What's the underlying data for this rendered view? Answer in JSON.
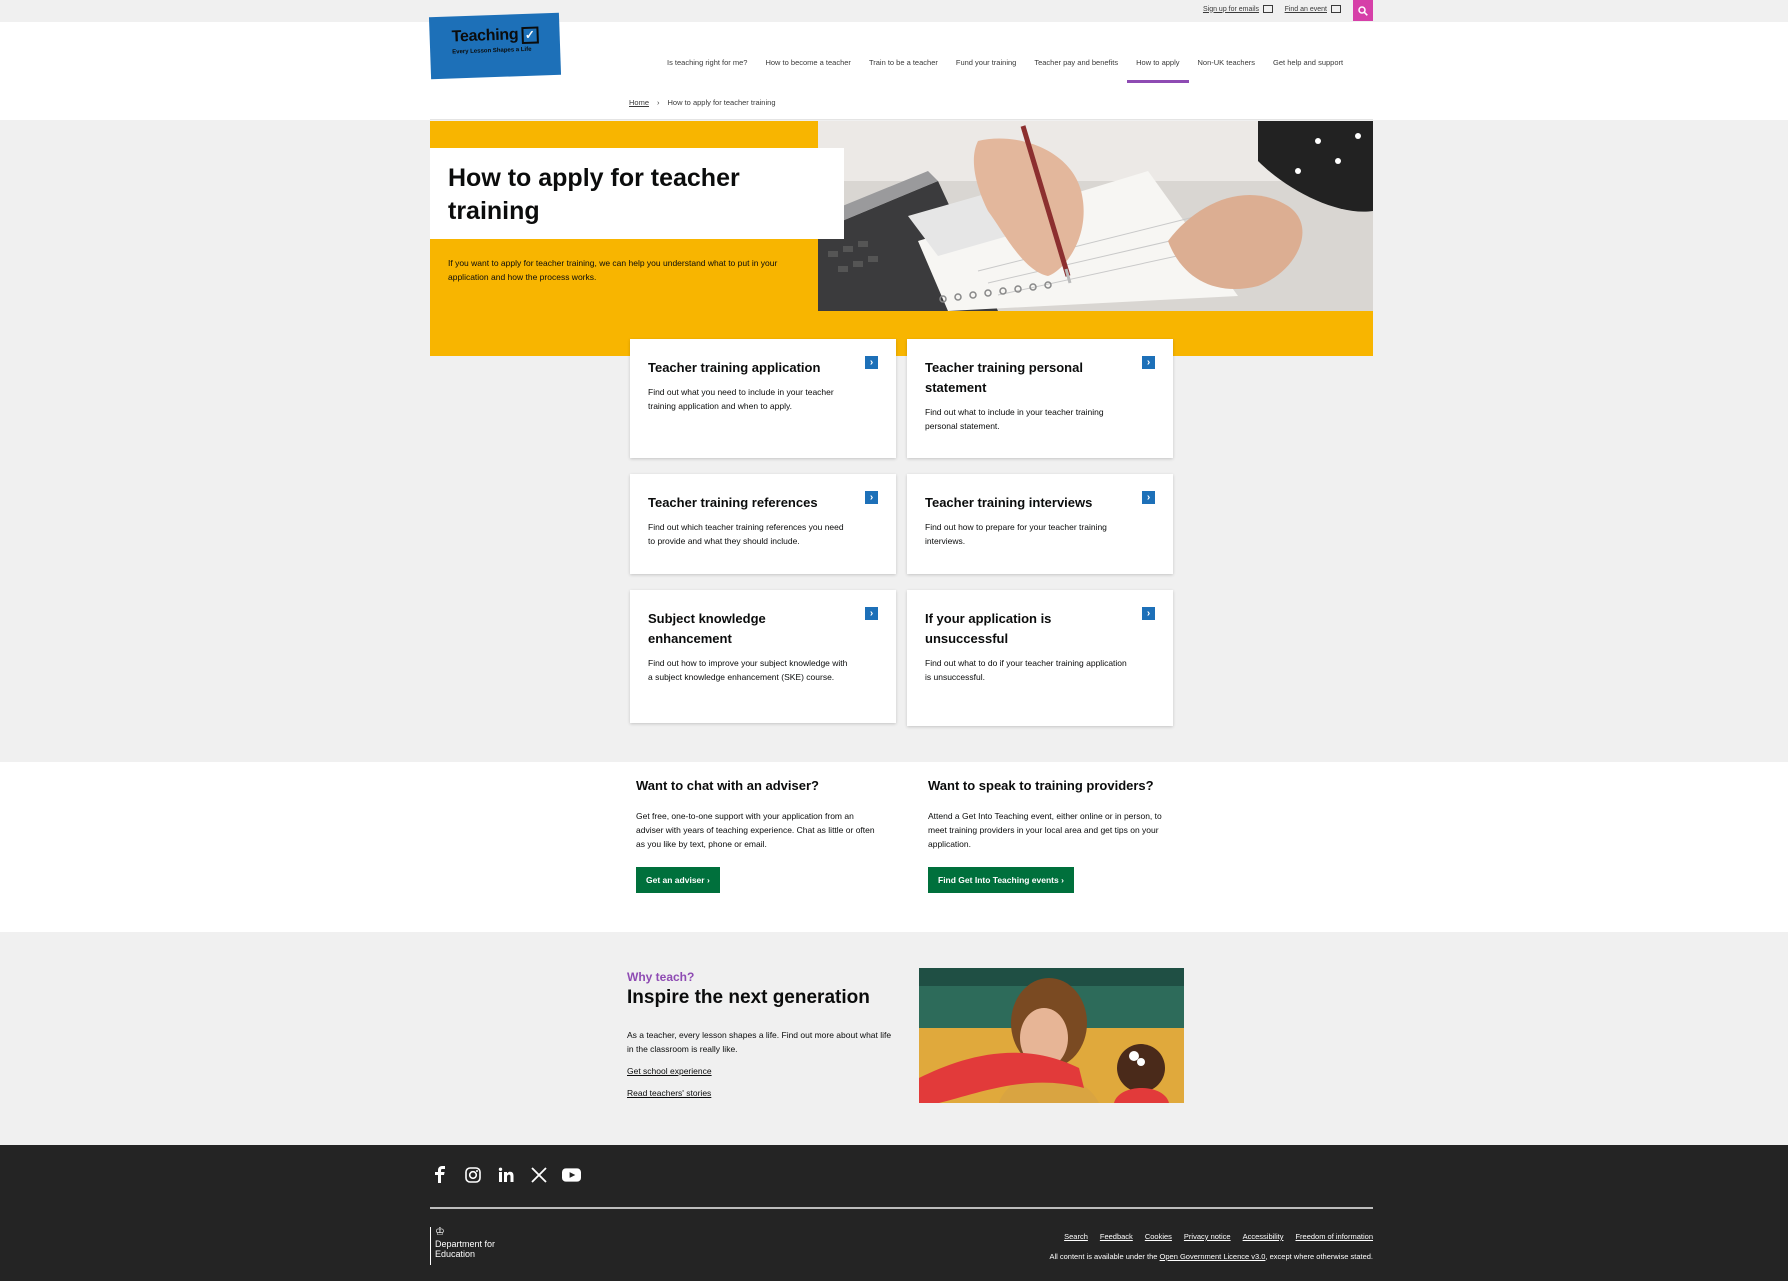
{
  "topbar": {
    "signup_label": "Sign up for emails",
    "event_label": "Find an event"
  },
  "logo": {
    "word": "Teaching",
    "tagline": "Every Lesson Shapes a Life"
  },
  "nav": {
    "items": [
      {
        "label": "Is teaching right for me?"
      },
      {
        "label": "How to become a teacher"
      },
      {
        "label": "Train to be a teacher"
      },
      {
        "label": "Fund your training"
      },
      {
        "label": "Teacher pay and benefits"
      },
      {
        "label": "How to apply"
      },
      {
        "label": "Non-UK teachers"
      },
      {
        "label": "Get help and support"
      }
    ],
    "active": "How to apply"
  },
  "breadcrumb": {
    "home": "Home",
    "separator": "›",
    "current": "How to apply for teacher training"
  },
  "hero": {
    "title": "How to apply for teacher training",
    "intro": "If you want to apply for teacher training, we can help you understand what to put in your application and how the process works."
  },
  "cards": [
    {
      "title": "Teacher training application",
      "desc": "Find out what you need to include in your teacher training application and when to apply."
    },
    {
      "title": "Teacher training personal statement",
      "desc": "Find out what to include in your teacher training personal statement."
    },
    {
      "title": "Teacher training references",
      "desc": "Find out which teacher training references you need to provide and what they should include."
    },
    {
      "title": "Teacher training interviews",
      "desc": "Find out how to prepare for your teacher training interviews."
    },
    {
      "title": "Subject knowledge enhancement",
      "desc": "Find out how to improve your subject knowledge with a subject knowledge enhancement (SKE) course."
    },
    {
      "title": "If your application is unsuccessful",
      "desc": "Find out what to do if your teacher training application is unsuccessful."
    }
  ],
  "help": {
    "adviser": {
      "title": "Want to chat with an adviser?",
      "text": "Get free, one-to-one support with your application from an adviser with years of teaching experience. Chat as little or often as you like by text, phone or email.",
      "button": "Get an adviser"
    },
    "providers": {
      "title": "Want to speak to training providers?",
      "text": "Attend a Get Into Teaching event, either online or in person, to meet training providers in your local area and get tips on your application.",
      "button": "Find Get Into Teaching events"
    }
  },
  "why": {
    "kicker": "Why teach?",
    "title": "Inspire the next generation",
    "text": "As a teacher, every lesson shapes a life. Find out more about what life in the classroom is really like.",
    "link1": "Get school experience",
    "link2": "Read teachers' stories"
  },
  "footer": {
    "dept": "Department for Education",
    "links": [
      "Search",
      "Feedback",
      "Cookies",
      "Privacy notice",
      "Accessibility",
      "Freedom of information"
    ],
    "licence_prefix": "All content is available under the",
    "licence_link": "Open Government Licence v3.0",
    "licence_suffix": ", except where otherwise stated."
  },
  "colors": {
    "brand_blue": "#1d70b8",
    "accent_yellow": "#f8b500",
    "purple": "#8e4bb3",
    "green_button": "#00703c",
    "search_pink": "#d63fa8",
    "footer_bg": "#242424"
  }
}
